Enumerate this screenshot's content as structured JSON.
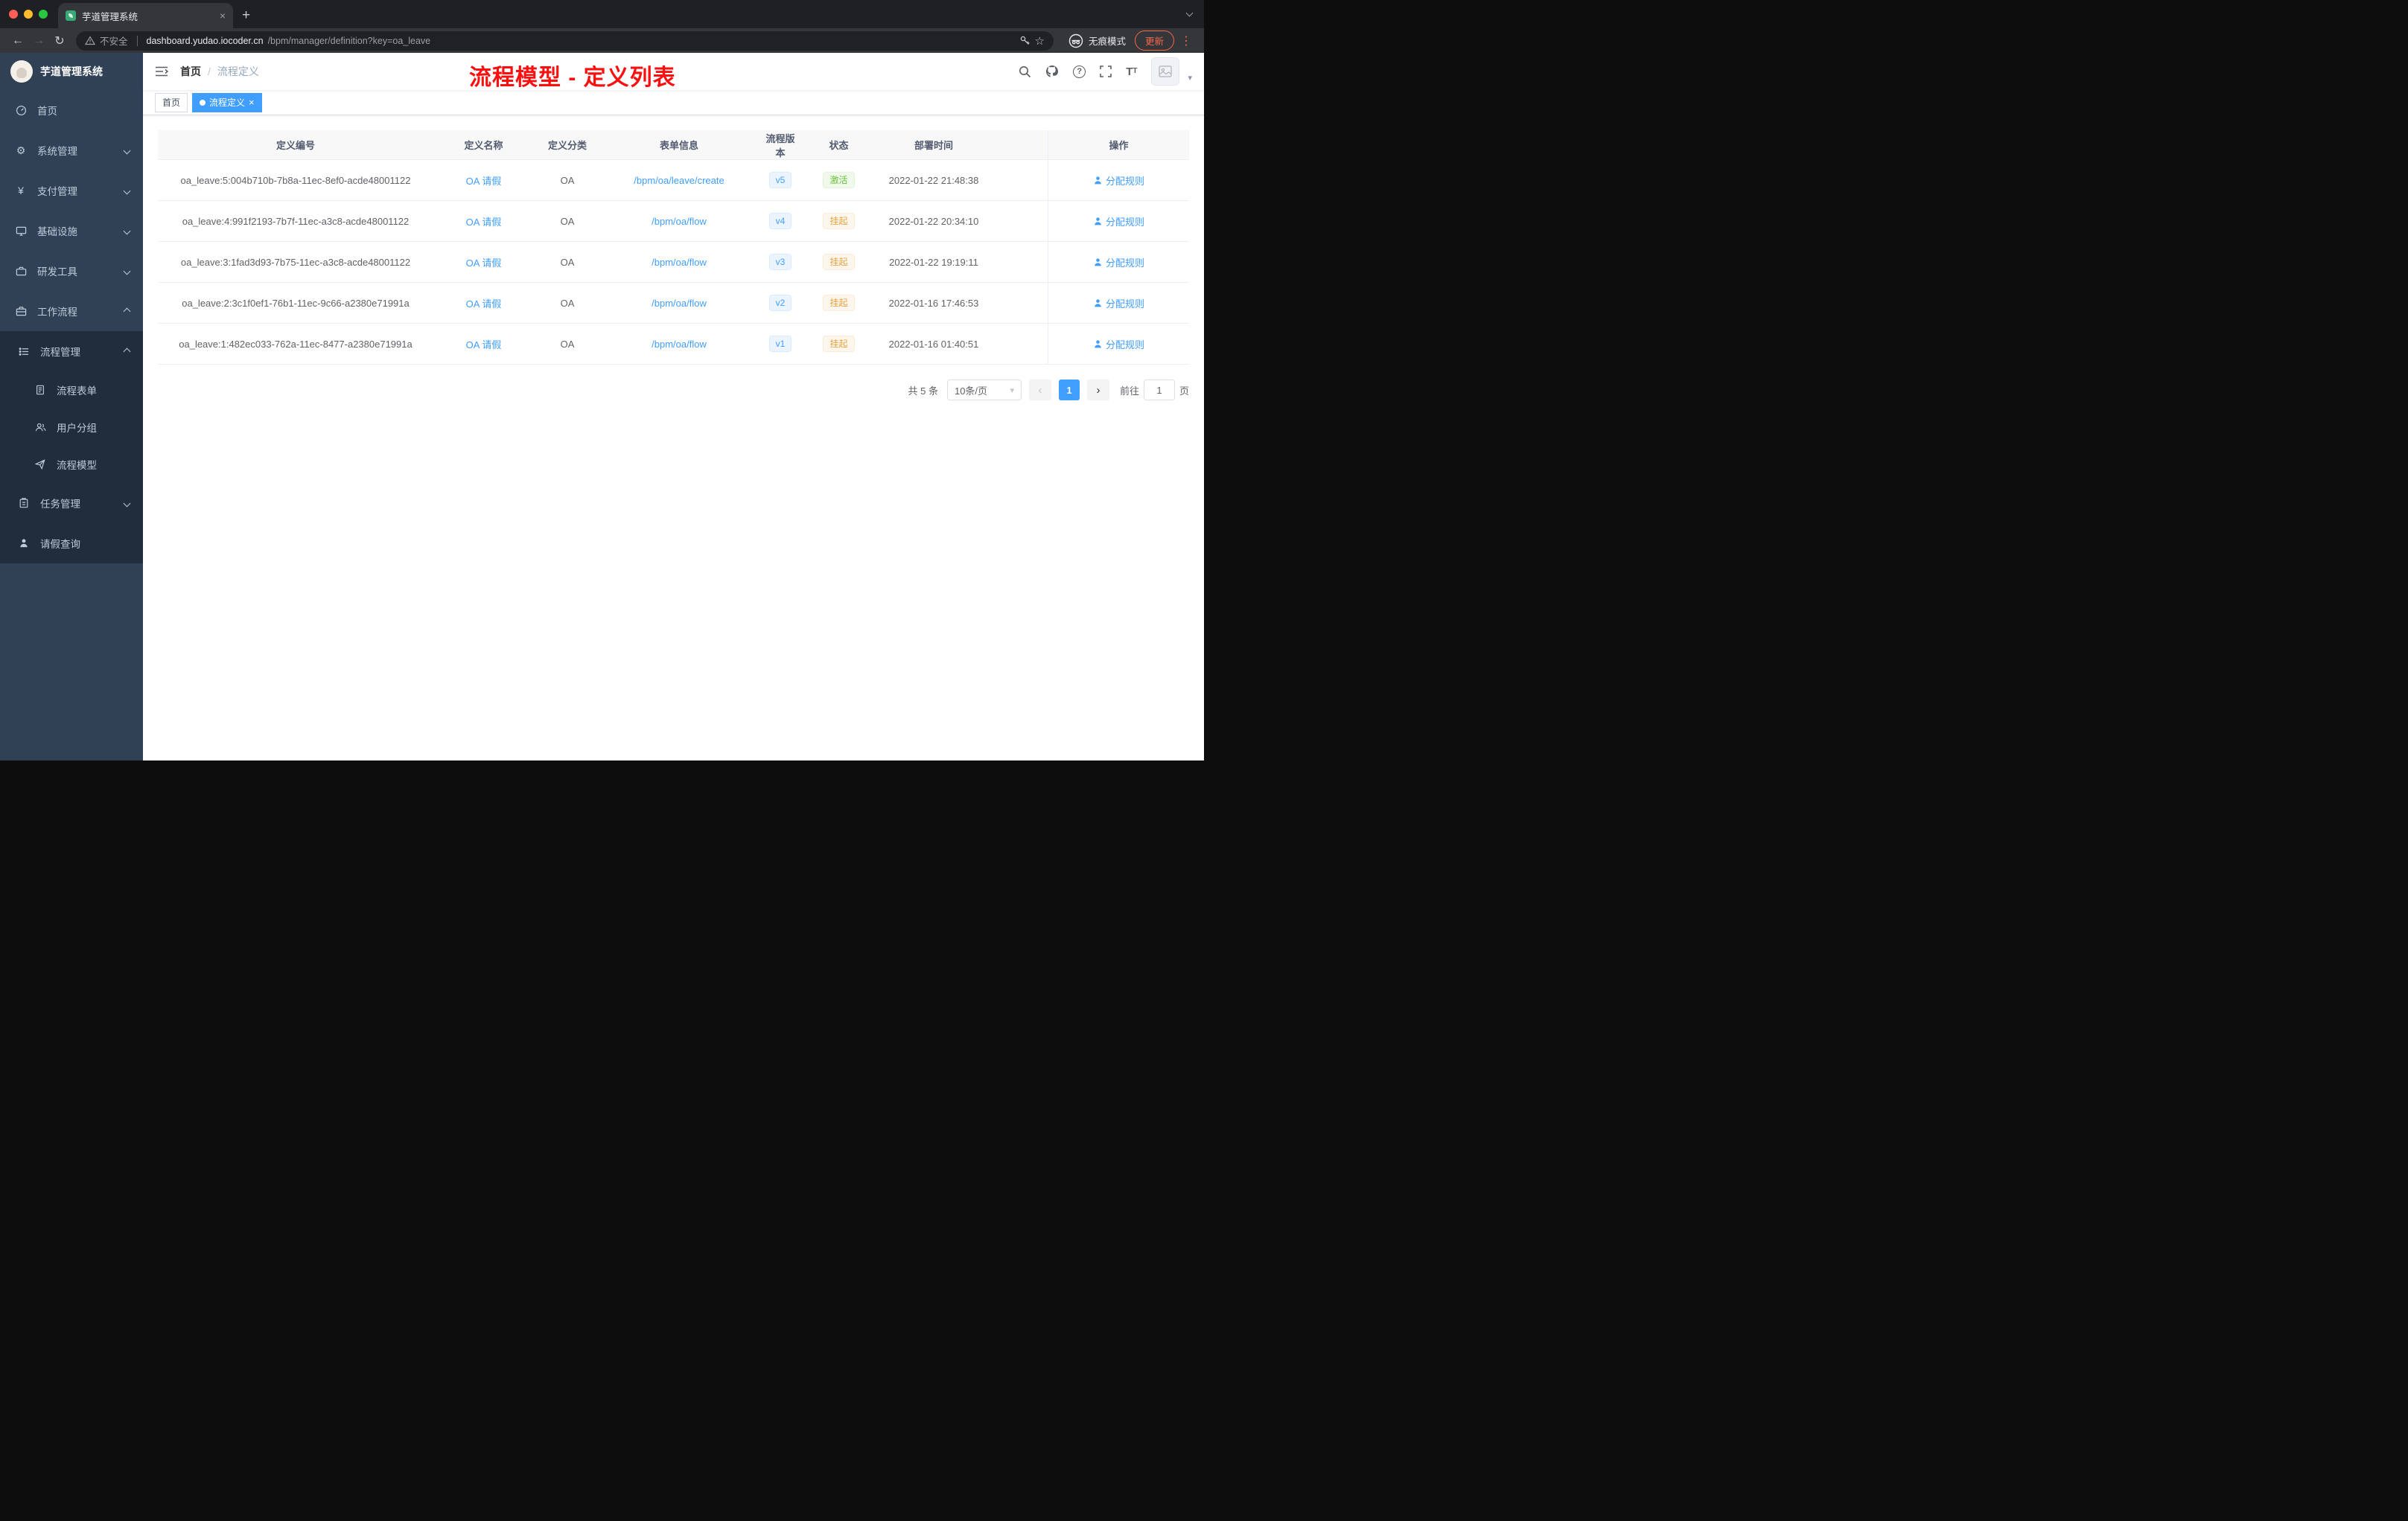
{
  "browser": {
    "tab_title": "芋道管理系统",
    "security_label": "不安全",
    "url_host": "dashboard.yudao.iocoder.cn",
    "url_path": "/bpm/manager/definition?key=oa_leave",
    "incognito_label": "无痕模式",
    "update_label": "更新"
  },
  "icons": {
    "close": "×",
    "plus": "+",
    "back": "←",
    "forward": "→",
    "reload": "↻",
    "star": "☆",
    "dots": "⋮",
    "gear": "⚙",
    "yen": "¥",
    "caret_down": "▾",
    "question": "?",
    "breadcrumb_sep": "/",
    "prev": "‹",
    "next": "›"
  },
  "sidebar": {
    "logo_title": "芋道管理系统",
    "items": [
      {
        "label": "首页"
      },
      {
        "label": "系统管理"
      },
      {
        "label": "支付管理"
      },
      {
        "label": "基础设施"
      },
      {
        "label": "研发工具"
      },
      {
        "label": "工作流程"
      }
    ],
    "submenu": [
      {
        "label": "流程管理"
      },
      {
        "label": "流程表单"
      },
      {
        "label": "用户分组"
      },
      {
        "label": "流程模型"
      },
      {
        "label": "任务管理"
      },
      {
        "label": "请假查询"
      }
    ]
  },
  "navbar": {
    "breadcrumb": [
      "首页",
      "流程定义"
    ]
  },
  "annotation": {
    "text": "流程模型 - 定义列表",
    "color": "#fb1010"
  },
  "tags": [
    {
      "label": "首页"
    },
    {
      "label": "流程定义"
    }
  ],
  "table": {
    "columns": [
      "定义编号",
      "定义名称",
      "定义分类",
      "表单信息",
      "流程版本",
      "状态",
      "部署时间",
      "操作"
    ],
    "action_label": "分配规则",
    "rows": [
      {
        "id": "oa_leave:5:004b710b-7b8a-11ec-8ef0-acde48001122",
        "name": "OA 请假",
        "category": "OA",
        "form": "/bpm/oa/leave/create",
        "version": "v5",
        "status": "激活",
        "time": "2022-01-22 21:48:38"
      },
      {
        "id": "oa_leave:4:991f2193-7b7f-11ec-a3c8-acde48001122",
        "name": "OA 请假",
        "category": "OA",
        "form": "/bpm/oa/flow",
        "version": "v4",
        "status": "挂起",
        "time": "2022-01-22 20:34:10"
      },
      {
        "id": "oa_leave:3:1fad3d93-7b75-11ec-a3c8-acde48001122",
        "name": "OA 请假",
        "category": "OA",
        "form": "/bpm/oa/flow",
        "version": "v3",
        "status": "挂起",
        "time": "2022-01-22 19:19:11"
      },
      {
        "id": "oa_leave:2:3c1f0ef1-76b1-11ec-9c66-a2380e71991a",
        "name": "OA 请假",
        "category": "OA",
        "form": "/bpm/oa/flow",
        "version": "v2",
        "status": "挂起",
        "time": "2022-01-16 17:46:53"
      },
      {
        "id": "oa_leave:1:482ec033-762a-11ec-8477-a2380e71991a",
        "name": "OA 请假",
        "category": "OA",
        "form": "/bpm/oa/flow",
        "version": "v1",
        "status": "挂起",
        "time": "2022-01-16 01:40:51"
      }
    ]
  },
  "pagination": {
    "total": "共 5 条",
    "page_size": "10条/页",
    "current_page": "1",
    "goto_label": "前往",
    "goto_value": "1",
    "page_unit": "页"
  },
  "colors": {
    "accent": "#409eff",
    "status_active": "#67c23a",
    "status_suspended": "#e6a23c",
    "sidebar_bg": "#304156",
    "submenu_bg": "#1f2d3d",
    "annotation_red": "#fb1010"
  }
}
